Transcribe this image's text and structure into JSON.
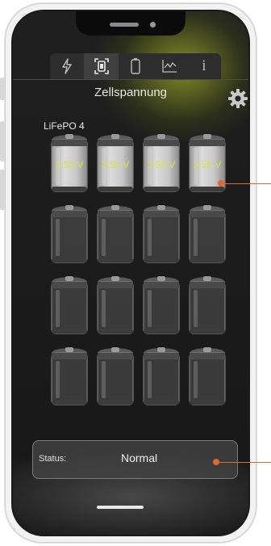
{
  "header": {
    "title": "Zellspannung"
  },
  "tabs": [
    {
      "icon": "lightning-icon",
      "active": false
    },
    {
      "icon": "battery-scan-icon",
      "active": true
    },
    {
      "icon": "battery-icon",
      "active": false
    },
    {
      "icon": "chart-icon",
      "active": false
    },
    {
      "icon": "info-icon",
      "label": "i",
      "active": false
    }
  ],
  "battery": {
    "chemistry": "LiFePO 4",
    "cell_voltages": [
      "3.55 V",
      "3.55 V",
      "3.55 V",
      "3.55 V"
    ],
    "empty_cells": 12
  },
  "status": {
    "label": "Status:",
    "value": "Normal"
  },
  "colors": {
    "accent": "#e06a2a",
    "voltage_text": "#d8e24a",
    "glow": "#91a028"
  }
}
